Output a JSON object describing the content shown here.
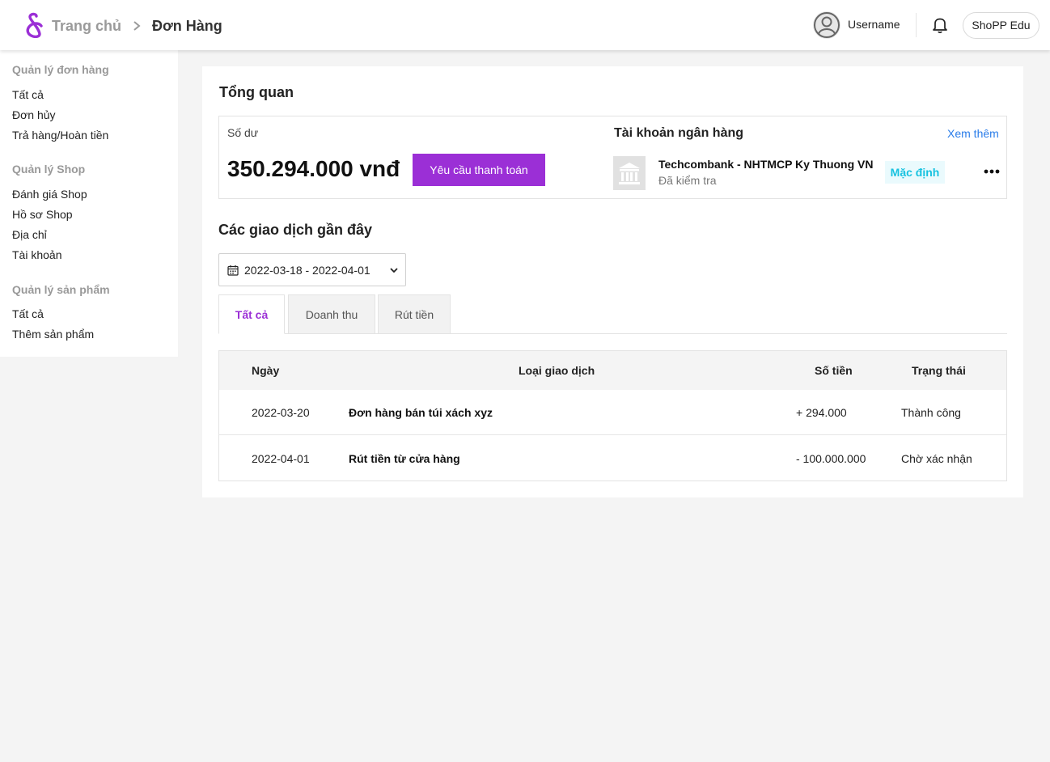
{
  "header": {
    "breadcrumb_home": "Trang chủ",
    "breadcrumb_current": "Đơn Hàng",
    "username": "Username",
    "shop_name": "ShoPP Edu",
    "brand_color": "#9b2fd6"
  },
  "sidebar": {
    "sections": [
      {
        "title": "Quản lý đơn hàng",
        "items": [
          "Tất cả",
          "Đơn hủy",
          "Trả hàng/Hoàn tiền"
        ]
      },
      {
        "title": "Quản lý Shop",
        "items": [
          "Đánh giá Shop",
          "Hồ sơ Shop",
          "Địa chỉ",
          "Tài khoản"
        ]
      },
      {
        "title": "Quản lý sản phẩm",
        "items": [
          "Tất cả",
          "Thêm sản phẩm"
        ]
      }
    ]
  },
  "overview": {
    "title": "Tổng quan",
    "balance_label": "Số dư",
    "balance_amount": "350.294.000 vnđ",
    "pay_button": "Yêu cầu thanh toán",
    "bank_section_title": "Tài khoản ngân hàng",
    "see_more": "Xem thêm",
    "bank_name": "Techcombank - NHTMCP Ky Thuong VN",
    "bank_status": "Đã kiểm tra",
    "default_badge": "Mặc định"
  },
  "transactions": {
    "title": "Các giao dịch gần đây",
    "date_range": "2022-03-18 - 2022-04-01",
    "tabs": [
      "Tất cả",
      "Doanh thu",
      "Rút tiền"
    ],
    "active_tab": "Tất cả",
    "columns": [
      "Ngày",
      "Loại giao dịch",
      "Số tiền",
      "Trạng thái"
    ],
    "rows": [
      {
        "date": "2022-03-20",
        "type": "Đơn hàng bán túi xách xyz",
        "amount": "+ 294.000",
        "status": "Thành công"
      },
      {
        "date": "2022-04-01",
        "type": "Rút tiền từ cửa hàng",
        "amount": "- 100.000.000",
        "status": "Chờ xác nhận"
      }
    ]
  }
}
